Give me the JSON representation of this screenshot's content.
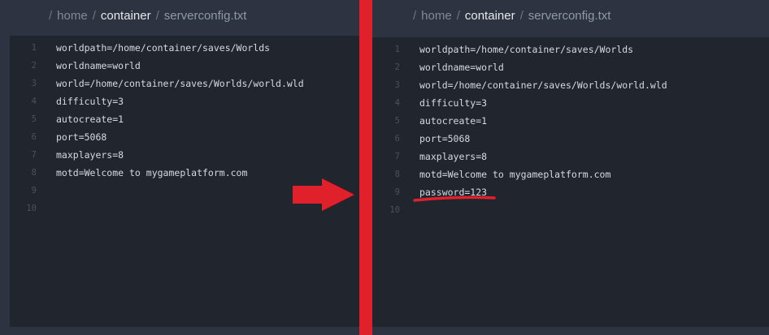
{
  "left": {
    "breadcrumb": {
      "sep": "/",
      "crumb1": "home",
      "crumb2": "container",
      "filename": "serverconfig.txt"
    },
    "lines": [
      {
        "num": "1",
        "text": "worldpath=/home/container/saves/Worlds"
      },
      {
        "num": "2",
        "text": "worldname=world"
      },
      {
        "num": "3",
        "text": "world=/home/container/saves/Worlds/world.wld"
      },
      {
        "num": "4",
        "text": "difficulty=3"
      },
      {
        "num": "5",
        "text": "autocreate=1"
      },
      {
        "num": "6",
        "text": "port=5068"
      },
      {
        "num": "7",
        "text": "maxplayers=8"
      },
      {
        "num": "8",
        "text": "motd=Welcome to mygameplatform.com"
      },
      {
        "num": "9",
        "text": ""
      },
      {
        "num": "10",
        "text": ""
      }
    ]
  },
  "right": {
    "breadcrumb": {
      "sep": "/",
      "crumb1": "home",
      "crumb2": "container",
      "filename": "serverconfig.txt"
    },
    "lines": [
      {
        "num": "1",
        "text": "worldpath=/home/container/saves/Worlds"
      },
      {
        "num": "2",
        "text": "worldname=world"
      },
      {
        "num": "3",
        "text": "world=/home/container/saves/Worlds/world.wld"
      },
      {
        "num": "4",
        "text": "difficulty=3"
      },
      {
        "num": "5",
        "text": "autocreate=1"
      },
      {
        "num": "6",
        "text": "port=5068"
      },
      {
        "num": "7",
        "text": "maxplayers=8"
      },
      {
        "num": "8",
        "text": "motd=Welcome to mygameplatform.com"
      },
      {
        "num": "9",
        "text": "password=123"
      },
      {
        "num": "10",
        "text": ""
      }
    ]
  },
  "annotations": {
    "divider_color": "#e0202a",
    "arrow_icon": "right-arrow-icon",
    "highlight_color": "#e0202a"
  }
}
